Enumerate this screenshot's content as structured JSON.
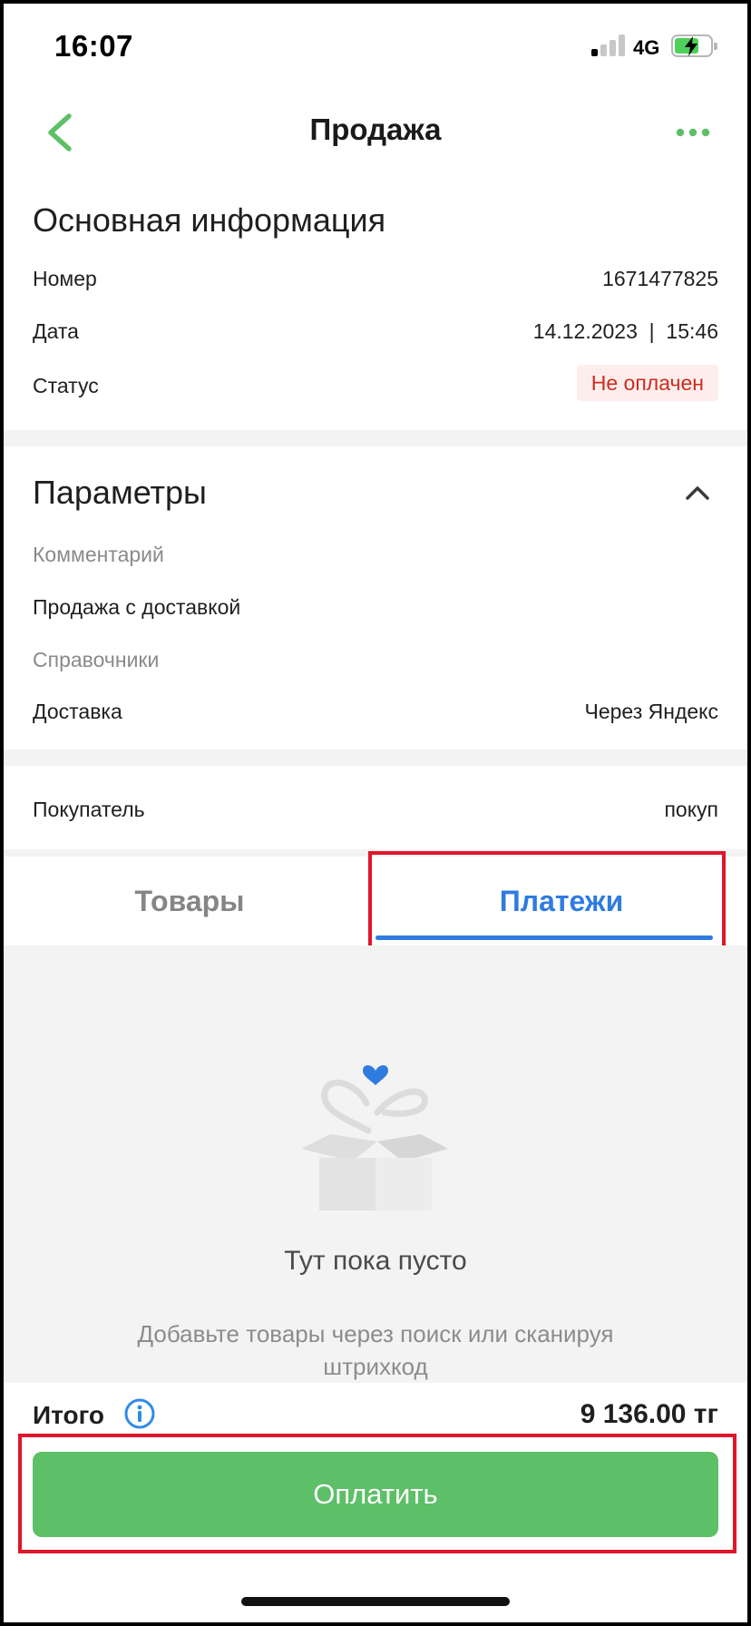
{
  "status_bar": {
    "time": "16:07",
    "network": "4G",
    "signal_bars_active": 1,
    "signal_bars_total": 4,
    "battery_charging": true
  },
  "nav": {
    "title": "Продажа",
    "back_icon": "chevron-left-icon",
    "more_icon": "more-dots-icon",
    "accent_color": "#5dbf67"
  },
  "main_info": {
    "title": "Основная информация",
    "rows": [
      {
        "label": "Номер",
        "value": "1671477825"
      },
      {
        "label": "Дата",
        "value": "14.12.2023  |  15:46"
      },
      {
        "label": "Статус",
        "value": "Не оплачен"
      }
    ],
    "status_color": "#cf2b1e"
  },
  "params": {
    "title": "Параметры",
    "collapse_icon": "chevron-up-icon",
    "comment_label": "Комментарий",
    "comment_value": "Продажа с доставкой",
    "directories_label": "Справочники",
    "delivery_label": "Доставка",
    "delivery_value": "Через Яндекс"
  },
  "buyer": {
    "label": "Покупатель",
    "value": "покуп"
  },
  "tabs": [
    {
      "label": "Товары",
      "active": false
    },
    {
      "label": "Платежи",
      "active": true
    }
  ],
  "empty_state": {
    "icon": "empty-box-icon",
    "title": "Тут пока пусто",
    "subtitle": "Добавьте товары через поиск или сканируя штрихкод"
  },
  "footer": {
    "total_label": "Итого",
    "total_value": "9 136.00 тг",
    "pay_label": "Оплатить",
    "pay_color": "#5dbf67"
  }
}
